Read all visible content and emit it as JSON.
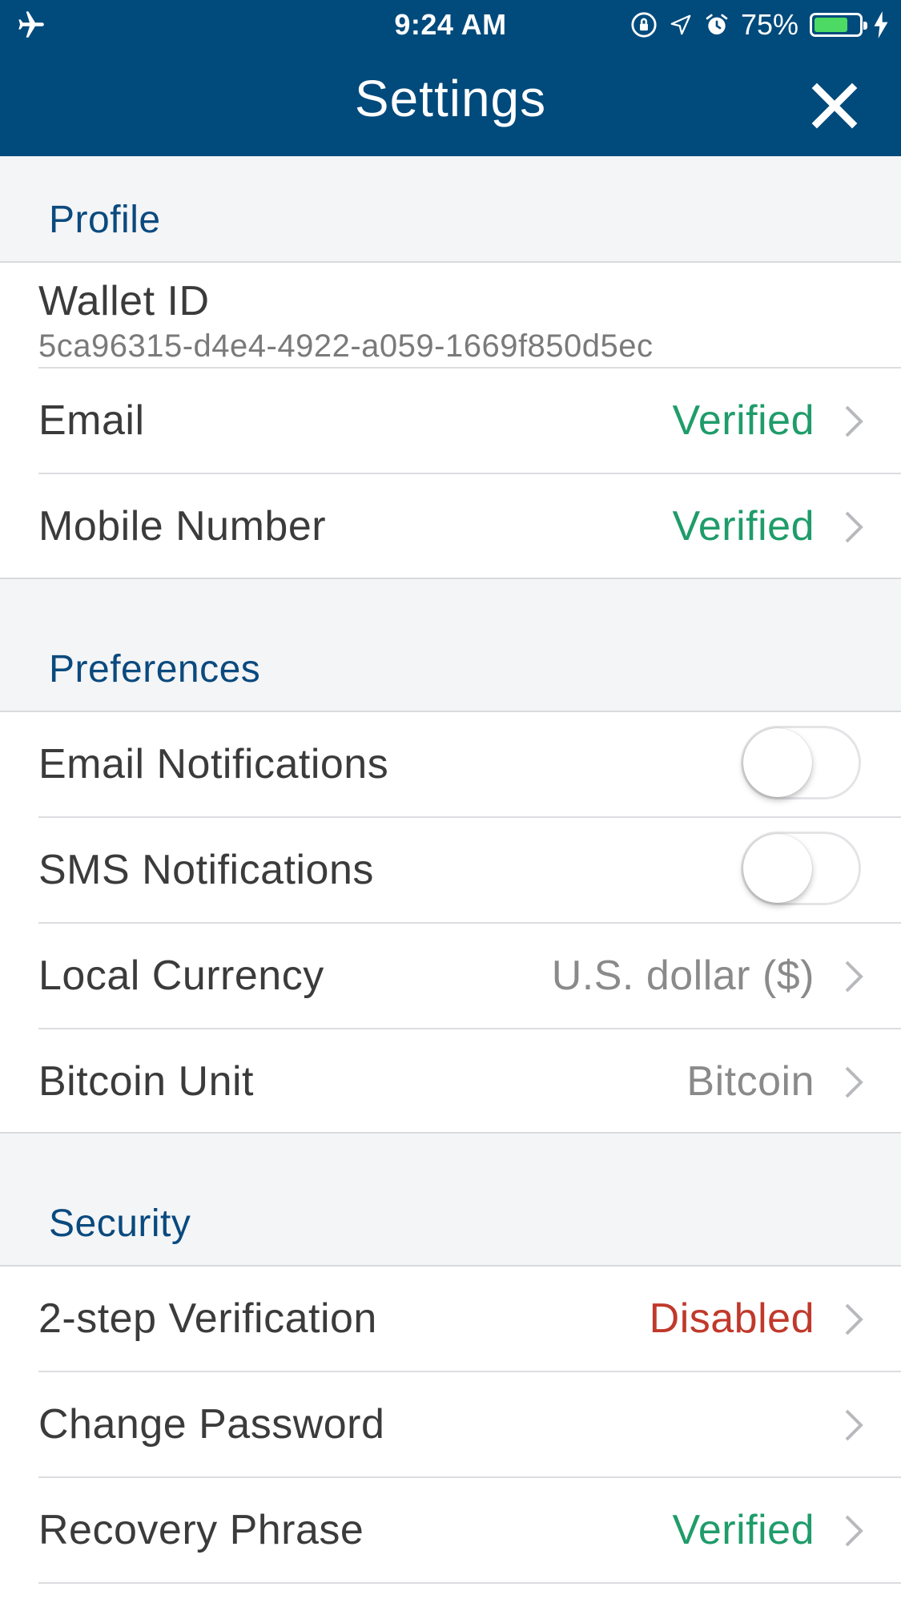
{
  "status_bar": {
    "time": "9:24 AM",
    "battery_percent": "75%",
    "battery_level": 0.75,
    "icons": [
      "airplane-icon",
      "orientation-lock-icon",
      "location-icon",
      "alarm-icon",
      "battery-icon",
      "charging-icon"
    ]
  },
  "header": {
    "title": "Settings",
    "close_icon": "close-icon",
    "background_color": "#004a7c"
  },
  "colors": {
    "verified": "#1f9c6a",
    "disabled": "#c0392b",
    "muted_value": "#8a8a8a",
    "section_label": "#0a4a7e"
  },
  "profile": {
    "section_label": "Profile",
    "wallet_label": "Wallet ID",
    "wallet_id": "5ca96315-d4e4-4922-a059-1669f850d5ec",
    "email": {
      "label": "Email",
      "value": "Verified",
      "status": "verified"
    },
    "mobile": {
      "label": "Mobile Number",
      "value": "Verified",
      "status": "verified"
    }
  },
  "preferences": {
    "section_label": "Preferences",
    "email_notifications": {
      "label": "Email Notifications",
      "on": false
    },
    "sms_notifications": {
      "label": "SMS Notifications",
      "on": false
    },
    "local_currency": {
      "label": "Local Currency",
      "value": "U.S. dollar ($)"
    },
    "bitcoin_unit": {
      "label": "Bitcoin Unit",
      "value": "Bitcoin"
    }
  },
  "security": {
    "section_label": "Security",
    "two_step": {
      "label": "2-step Verification",
      "value": "Disabled",
      "status": "disabled"
    },
    "change_password": {
      "label": "Change Password",
      "value": ""
    },
    "recovery_phrase": {
      "label": "Recovery Phrase",
      "value": "Verified",
      "status": "verified"
    }
  }
}
